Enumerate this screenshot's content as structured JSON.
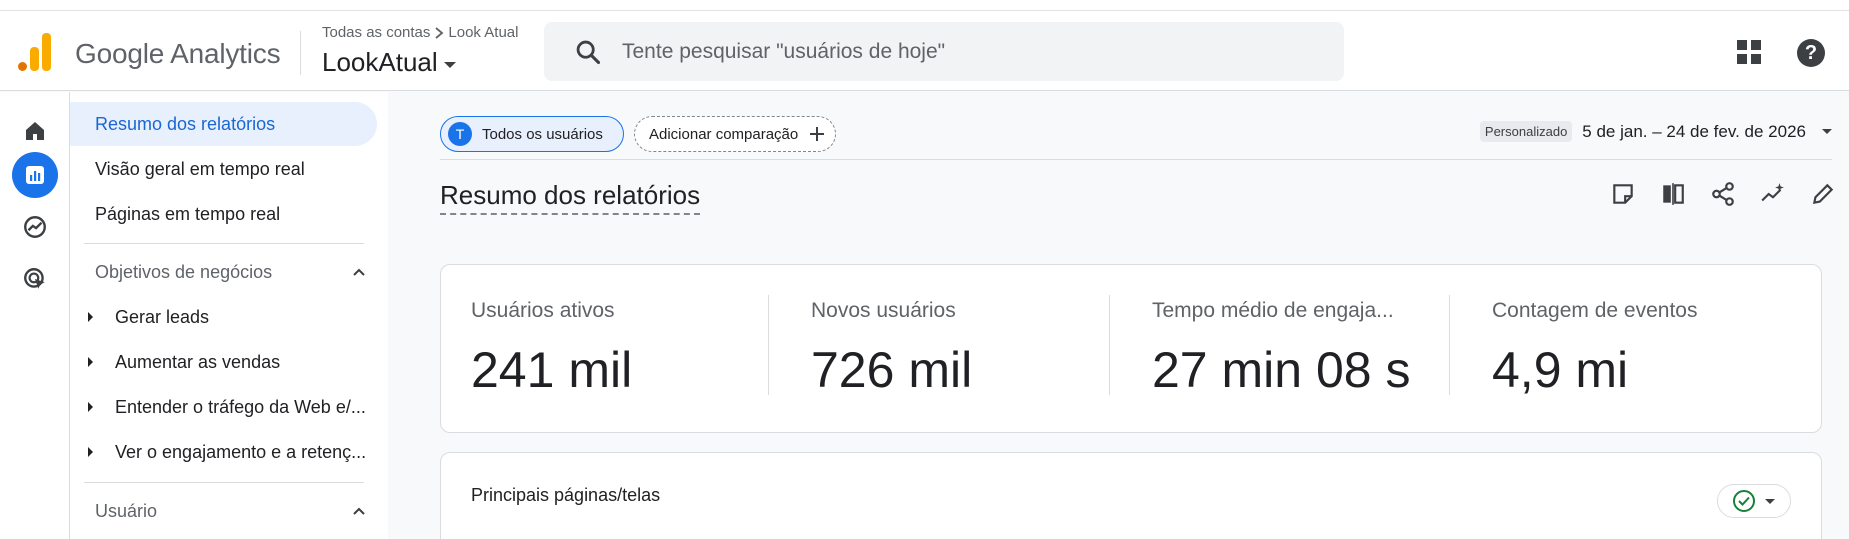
{
  "header": {
    "brand": "Google Analytics",
    "breadcrumb": {
      "account": "Todas as contas",
      "property": "Look Atual"
    },
    "property_name": "LookAtual",
    "search": {
      "placeholder": "Tente pesquisar \"usuários de hoje\""
    },
    "help_label": "?"
  },
  "colors": {
    "accent": "#1a73e8",
    "logo_orange": "#f9ab00",
    "logo_dark": "#e37400",
    "success": "#188038"
  },
  "rail": [
    "home-icon",
    "reports-icon",
    "explore-icon",
    "advertising-icon"
  ],
  "nav": {
    "items": [
      {
        "label": "Resumo dos relatórios",
        "selected": true
      },
      {
        "label": "Visão geral em tempo real"
      },
      {
        "label": "Páginas em tempo real"
      }
    ],
    "section1": {
      "label": "Objetivos de negócios",
      "children": [
        "Gerar leads",
        "Aumentar as vendas",
        "Entender o tráfego da Web e/...",
        "Ver o engajamento e a retenç..."
      ]
    },
    "section2": {
      "label": "Usuário"
    }
  },
  "toolbar": {
    "all_users_initial": "T",
    "all_users": "Todos os usuários",
    "add_comparison": "Adicionar comparação",
    "date_tag": "Personalizado",
    "date_range": "5 de jan. – 24 de fev. de 2026"
  },
  "page_title": "Resumo dos relatórios",
  "metrics": [
    {
      "label": "Usuários ativos",
      "value": "241 mil"
    },
    {
      "label": "Novos usuários",
      "value": "726 mil"
    },
    {
      "label": "Tempo médio de engaja...",
      "value": "27 min 08 s"
    },
    {
      "label": "Contagem de eventos",
      "value": "4,9 mi"
    }
  ],
  "top_pages": {
    "title": "Principais páginas/telas"
  }
}
